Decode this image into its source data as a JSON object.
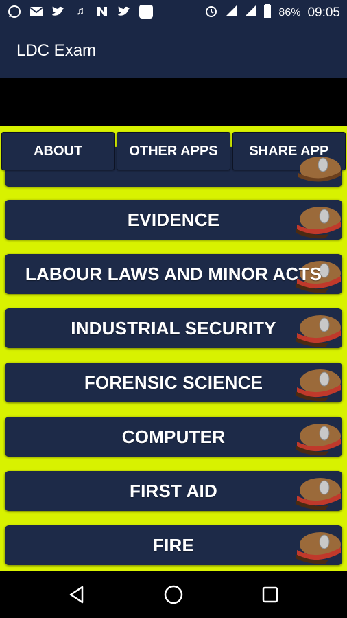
{
  "status_bar": {
    "icons": [
      "whatsapp-icon",
      "mail-icon",
      "twitter-icon",
      "music-icon",
      "news-icon",
      "twitter-icon",
      "app-icon"
    ],
    "battery": "86%",
    "time": "09:05"
  },
  "app_bar": {
    "title": "LDC Exam"
  },
  "top_buttons": [
    {
      "label": "ABOUT"
    },
    {
      "label": "OTHER APPS"
    },
    {
      "label": "SHARE APP"
    }
  ],
  "list_items": [
    {
      "label": ""
    },
    {
      "label": "EVIDENCE"
    },
    {
      "label": "LABOUR LAWS AND MINOR ACTS"
    },
    {
      "label": "INDUSTRIAL SECURITY"
    },
    {
      "label": "FORENSIC SCIENCE"
    },
    {
      "label": "COMPUTER"
    },
    {
      "label": "FIRST AID"
    },
    {
      "label": "FIRE"
    }
  ],
  "nav_bar": {
    "icons": [
      "back-icon",
      "home-icon",
      "recents-icon"
    ]
  },
  "colors": {
    "primary": "#1a2745",
    "button": "#1d2a48",
    "accent_background": "#d8f200"
  }
}
